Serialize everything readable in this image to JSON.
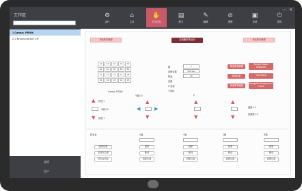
{
  "sidebar": {
    "title": "工作区",
    "items": [
      "1  Cantus_FR566",
      "2  2   BrunnenAre#TCR"
    ],
    "footer": [
      "说明",
      "用户"
    ]
  },
  "nav": [
    {
      "label": "运行",
      "icon": "⚙",
      "active": false
    },
    {
      "label": "主页",
      "icon": "⌂",
      "active": false
    },
    {
      "label": "手动控制",
      "icon": "✋",
      "active": true
    },
    {
      "label": "配方",
      "icon": "▤",
      "active": false
    },
    {
      "label": "编辑",
      "icon": "✎",
      "active": false
    },
    {
      "label": "报警",
      "icon": "⊘",
      "active": false
    },
    {
      "label": "系统",
      "icon": "▣",
      "active": false
    },
    {
      "label": "退出",
      "icon": "⏻",
      "active": false
    }
  ],
  "window_controls": "— ✕",
  "main": {
    "btn_left_top": "单击样本管理",
    "btn_center_top": "控制器/样本运行",
    "btn_right_top": "单击样本管理",
    "side_buttons": [
      "单击样本管理",
      "单击样本",
      "单击样本管理"
    ],
    "right_buttons": [
      "Sample Master Sequence",
      "Grid Stack",
      "Navigation Sequence in Frame"
    ],
    "grid_cells": [
      "A1",
      "A2",
      "A3",
      "A4",
      "A5",
      "B1",
      "B2",
      "B3",
      "B4",
      "B5",
      "C1",
      "C2",
      "C3",
      "C4",
      "C5",
      "D1",
      "D2",
      "D3",
      "D4",
      "D5"
    ],
    "grid_caption": "Cantus_FR566",
    "form_labels": [
      "模",
      "滤网位置",
      "样品",
      "位置",
      "X-坐标",
      "Y-坐标"
    ],
    "form_values": [
      "1",
      "Grid Jeu",
      "25"
    ],
    "axis_x_label": "X轴  0.0",
    "axis_y_label": "Y轴  0.0",
    "z_label": "Z",
    "step_labels": [
      "步进 1",
      "步进 1"
    ],
    "speed_label": "速度  0.0",
    "accel_label": "加速度  0.0",
    "bottom_cols": [
      {
        "title": "样本台",
        "buttons": [
          "回零位置",
          "去样本位置",
          "样本台调控"
        ]
      },
      {
        "title": "X轴",
        "buttons": [
          "回零",
          "移动",
          "调整位置"
        ]
      },
      {
        "title": "Y轴",
        "buttons": [
          "回零",
          "移动",
          "调整位置"
        ]
      },
      {
        "title": "Z轴",
        "buttons": [
          "回零",
          "移动",
          "调整位置"
        ]
      },
      {
        "title": "R轴",
        "buttons": [
          "回零",
          "移动",
          "调整位置"
        ]
      }
    ]
  }
}
